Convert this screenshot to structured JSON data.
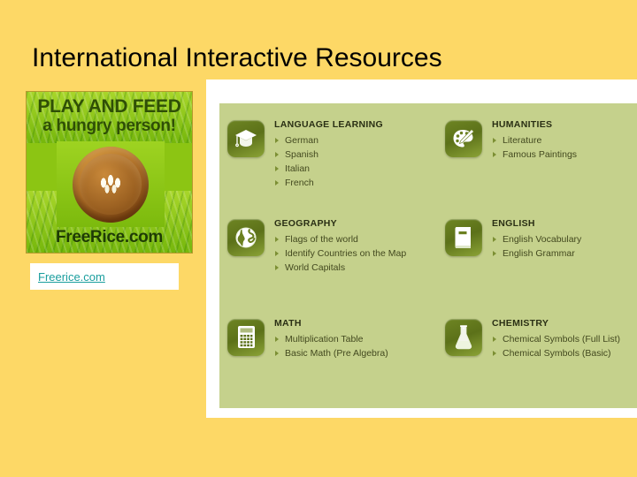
{
  "page": {
    "title": "International Interactive Resources",
    "background_color": "#fdd866",
    "panel_color": "#ffffff",
    "grid_color": "#c5d18c",
    "link_color": "#1a9e9e",
    "icon_color": "#5c7119"
  },
  "ad": {
    "headline1": "PLAY AND FEED",
    "headline2": "a hungry person!",
    "domain": "FreeRice.com",
    "image_name": "bowl-of-rice-on-grass"
  },
  "link": {
    "label": "Freerice.com"
  },
  "categories": [
    {
      "title": "LANGUAGE LEARNING",
      "icon": "graduation-cap-icon",
      "items": [
        "German",
        "Spanish",
        "Italian",
        "French"
      ]
    },
    {
      "title": "HUMANITIES",
      "icon": "paint-palette-icon",
      "items": [
        "Literature",
        "Famous Paintings"
      ]
    },
    {
      "title": "GEOGRAPHY",
      "icon": "globe-icon",
      "items": [
        "Flags of the world",
        "Identify Countries on the Map",
        "World Capitals"
      ]
    },
    {
      "title": "ENGLISH",
      "icon": "book-icon",
      "items": [
        "English Vocabulary",
        "English Grammar"
      ]
    },
    {
      "title": "MATH",
      "icon": "calculator-icon",
      "items": [
        "Multiplication Table",
        "Basic Math (Pre Algebra)"
      ]
    },
    {
      "title": "CHEMISTRY",
      "icon": "flask-icon",
      "items": [
        "Chemical Symbols (Full List)",
        "Chemical Symbols (Basic)"
      ]
    }
  ]
}
